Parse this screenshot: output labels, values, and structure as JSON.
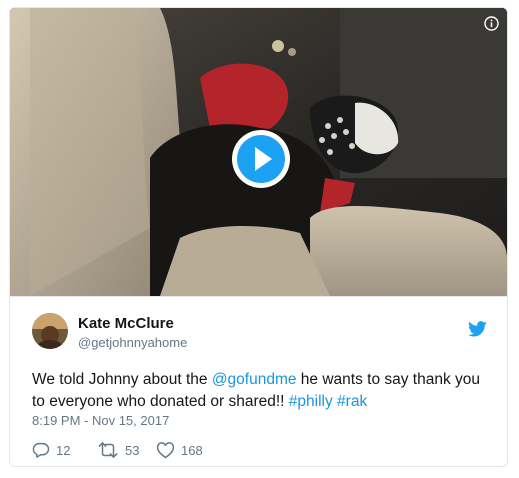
{
  "video": {
    "info_icon": "info-icon",
    "play_icon": "play-icon"
  },
  "author": {
    "name": "Kate McClure",
    "handle": "@getjohnnyahome",
    "avatar_icon": "avatar-photo"
  },
  "brand_icon": "twitter-bird-icon",
  "tweet": {
    "part1": "We told Johnny about the ",
    "mention": "@gofundme",
    "part2": " he wants to say thank you to everyone who donated or shared!! ",
    "hashtag1": "#philly",
    "space": " ",
    "hashtag2": "#rak"
  },
  "timestamp": "8:19 PM - Nov 15, 2017",
  "actions": {
    "replies": "12",
    "retweets": "53",
    "likes": "168"
  },
  "colors": {
    "link": "#1b95e0",
    "text": "#14171a",
    "muted": "#657786",
    "play_button": "#1da1f2"
  }
}
